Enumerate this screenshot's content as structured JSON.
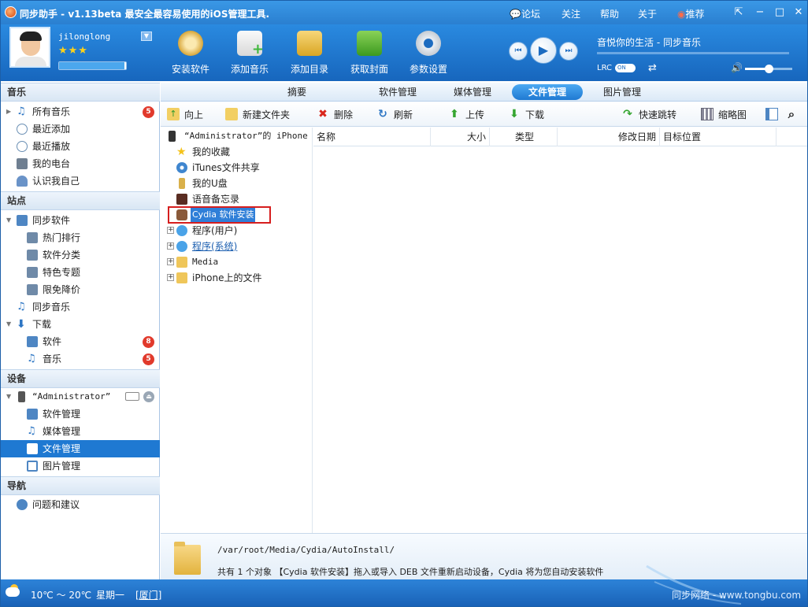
{
  "title": "同步助手 - v1.13beta 最安全最容易使用的iOS管理工具.",
  "title_links": {
    "forum": "论坛",
    "follow": "关注",
    "help": "帮助",
    "about": "关于",
    "recommend": "推荐"
  },
  "user": {
    "name": "jilonglong",
    "stars": "★★★",
    "level_fraction": 0.98
  },
  "header_buttons": {
    "install": "安装软件",
    "add_music": "添加音乐",
    "add_dir": "添加目录",
    "get_cover": "获取封面",
    "settings": "参数设置"
  },
  "player": {
    "now_playing": "音悦你的生活 - 同步音乐",
    "lrc": "LRC",
    "lrc_toggle": "ON",
    "volume": 0.5
  },
  "tabs": {
    "summary": "摘要",
    "software": "软件管理",
    "media": "媒体管理",
    "files": "文件管理",
    "photos": "图片管理"
  },
  "sidebar": {
    "music_header": "音乐",
    "all_music": "所有音乐",
    "all_music_badge": "5",
    "recent_add": "最近添加",
    "recent_play": "最近播放",
    "my_radio": "我的电台",
    "know_me": "认识我自己",
    "site_header": "站点",
    "sync_software": "同步软件",
    "hot_rank": "热门排行",
    "categories": "软件分类",
    "topics": "特色专题",
    "free_sale": "限免降价",
    "sync_music": "同步音乐",
    "download": "下载",
    "dl_software": "软件",
    "dl_software_badge": "8",
    "dl_music": "音乐",
    "dl_music_badge": "5",
    "device_header": "设备",
    "device_name": "“Administrator”",
    "dev_software": "软件管理",
    "dev_media": "媒体管理",
    "dev_files": "文件管理",
    "dev_photos": "图片管理",
    "nav_header": "导航",
    "feedback": "问题和建议"
  },
  "toolbar": {
    "up": "向上",
    "new_folder": "新建文件夹",
    "delete": "删除",
    "refresh": "刷新",
    "upload": "上传",
    "download": "下载",
    "jump": "快速跳转",
    "thumbnails": "缩略图"
  },
  "tree": {
    "root": "“Administrator”的 iPhone",
    "favorites": "我的收藏",
    "itunes_share": "iTunes文件共享",
    "udisk": "我的U盘",
    "voice_memo": "语音备忘录",
    "cydia": "Cydia 软件安装",
    "user_apps": "程序(用户)",
    "system_apps": "程序(系统)",
    "media": "Media",
    "iphone_files": "iPhone上的文件"
  },
  "list_columns": {
    "name": "名称",
    "size": "大小",
    "type": "类型",
    "modified": "修改日期",
    "target": "目标位置"
  },
  "info": {
    "path": "/var/root/Media/Cydia/AutoInstall/",
    "text": "共有 1 个对象  【Cydia 软件安装】拖入或导入 DEB 文件重新启动设备，Cydia 将为您自动安装软件"
  },
  "status": {
    "weather": "10℃ ～ 20℃",
    "weekday": "星期一",
    "city": "[厦门]",
    "site": "同步网络 - www.tongbu.com"
  },
  "colors": {
    "accent": "#1f79d2",
    "badge": "#e13a2c",
    "highlight_box": "#d61e1e"
  }
}
